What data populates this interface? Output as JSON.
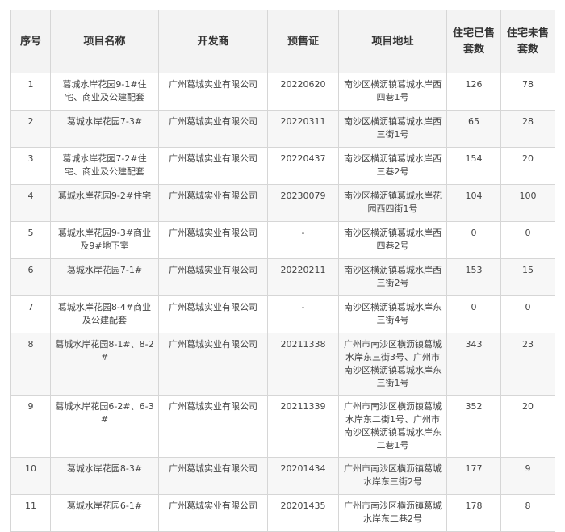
{
  "table": {
    "headers": [
      "序号",
      "项目名称",
      "开发商",
      "预售证",
      "项目地址",
      "住宅已售套数",
      "住宅未售套数"
    ],
    "rows": [
      [
        "1",
        "葛城水岸花园9-1#住宅、商业及公建配套",
        "广州葛城实业有限公司",
        "20220620",
        "南沙区横沥镇葛城水岸西四巷1号",
        "126",
        "78"
      ],
      [
        "2",
        "葛城水岸花园7-3#",
        "广州葛城实业有限公司",
        "20220311",
        "南沙区横沥镇葛城水岸西三街1号",
        "65",
        "28"
      ],
      [
        "3",
        "葛城水岸花园7-2#住宅、商业及公建配套",
        "广州葛城实业有限公司",
        "20220437",
        "南沙区横沥镇葛城水岸西三巷2号",
        "154",
        "20"
      ],
      [
        "4",
        "葛城水岸花园9-2#住宅",
        "广州葛城实业有限公司",
        "20230079",
        "南沙区横沥镇葛城水岸花园西四街1号",
        "104",
        "100"
      ],
      [
        "5",
        "葛城水岸花园9-3#商业及9#地下室",
        "广州葛城实业有限公司",
        "-",
        "南沙区横沥镇葛城水岸西四巷2号",
        "0",
        "0"
      ],
      [
        "6",
        "葛城水岸花园7-1#",
        "广州葛城实业有限公司",
        "20220211",
        "南沙区横沥镇葛城水岸西三街2号",
        "153",
        "15"
      ],
      [
        "7",
        "葛城水岸花园8-4#商业及公建配套",
        "广州葛城实业有限公司",
        "-",
        "南沙区横沥镇葛城水岸东三街4号",
        "0",
        "0"
      ],
      [
        "8",
        "葛城水岸花园8-1#、8-2#",
        "广州葛城实业有限公司",
        "20211338",
        "广州市南沙区横沥镇葛城水岸东三街3号、广州市南沙区横沥镇葛城水岸东三街1号",
        "343",
        "23"
      ],
      [
        "9",
        "葛城水岸花园6-2#、6-3#",
        "广州葛城实业有限公司",
        "20211339",
        "广州市南沙区横沥镇葛城水岸东二街1号、广州市南沙区横沥镇葛城水岸东二巷1号",
        "352",
        "20"
      ],
      [
        "10",
        "葛城水岸花园8-3#",
        "广州葛城实业有限公司",
        "20201434",
        "广州市南沙区横沥镇葛城水岸东三街2号",
        "177",
        "9"
      ],
      [
        "11",
        "葛城水岸花园6-1#",
        "广州葛城实业有限公司",
        "20201435",
        "广州市南沙区横沥镇葛城水岸东二巷2号",
        "178",
        "8"
      ]
    ]
  }
}
